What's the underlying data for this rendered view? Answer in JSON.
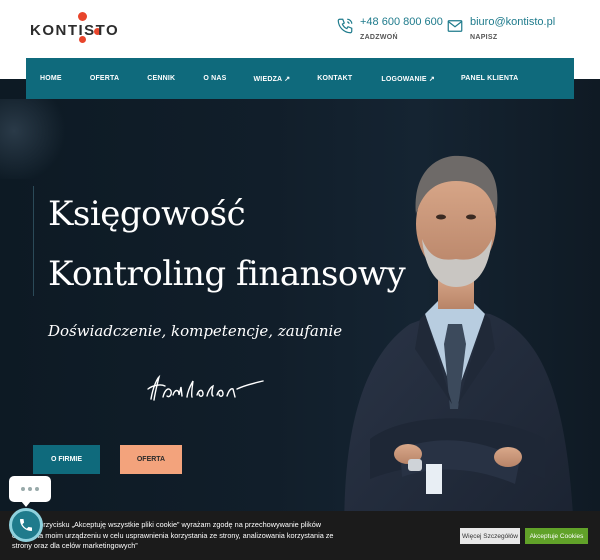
{
  "brand": {
    "logo_text": "KONTISTO",
    "accent": "#e8452b",
    "primary": "#0f6a7c"
  },
  "contacts": {
    "phone": {
      "value": "+48 600 800 600",
      "label": "ZADZWOŃ",
      "icon": "phone-icon"
    },
    "email": {
      "value": "biuro@kontisto.pl",
      "label": "NAPISZ",
      "icon": "mail-icon"
    }
  },
  "nav": {
    "items": [
      {
        "label": "HOME"
      },
      {
        "label": "OFERTA"
      },
      {
        "label": "CENNIK"
      },
      {
        "label": "O NAS"
      },
      {
        "label": "WIEDZA ↗"
      },
      {
        "label": "KONTAKT"
      },
      {
        "label": "LOGOWANIE ↗"
      },
      {
        "label": "PANEL KLIENTA"
      }
    ]
  },
  "hero": {
    "title_line1": "Księgowość",
    "title_line2": "Kontroling finansowy",
    "tagline": "Doświadczenie, kompetencje, zaufanie",
    "btn_firm": "O FIRMIE",
    "btn_offer": "OFERTA"
  },
  "cookie": {
    "text": "Klikając przycisku „Akceptuję wszystkie pliki cookie” wyrażam zgodę na przechowywanie plików cookie na moim urządzeniu w celu usprawnienia korzystania ze strony, analizowania korzystania ze strony oraz dla celów marketingowych”",
    "settings_label": "Więcej Szczegółów",
    "accept_label": "Akceptuje Cookies"
  }
}
